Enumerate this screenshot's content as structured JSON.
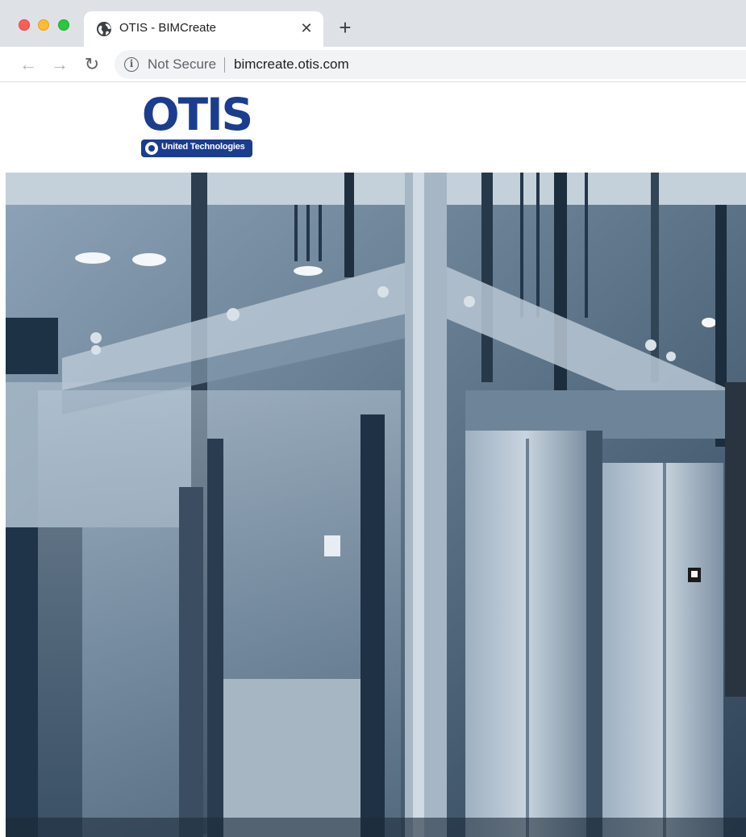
{
  "browser": {
    "tab": {
      "favicon": "globe-icon",
      "title": "OTIS - BIMCreate",
      "close_glyph": "✕"
    },
    "new_tab_glyph": "+",
    "toolbar": {
      "back_glyph": "←",
      "forward_glyph": "→",
      "reload_glyph": "↻",
      "security_icon": "info-icon",
      "security_label": "Not Secure",
      "url": "bimcreate.otis.com"
    }
  },
  "site": {
    "logo": {
      "wordmark": "OTIS",
      "tagline": "United Technologies",
      "brand_color": "#1b3d8f"
    },
    "hero": {
      "image_subject": "glass elevator",
      "tint": "#4a6075"
    }
  }
}
